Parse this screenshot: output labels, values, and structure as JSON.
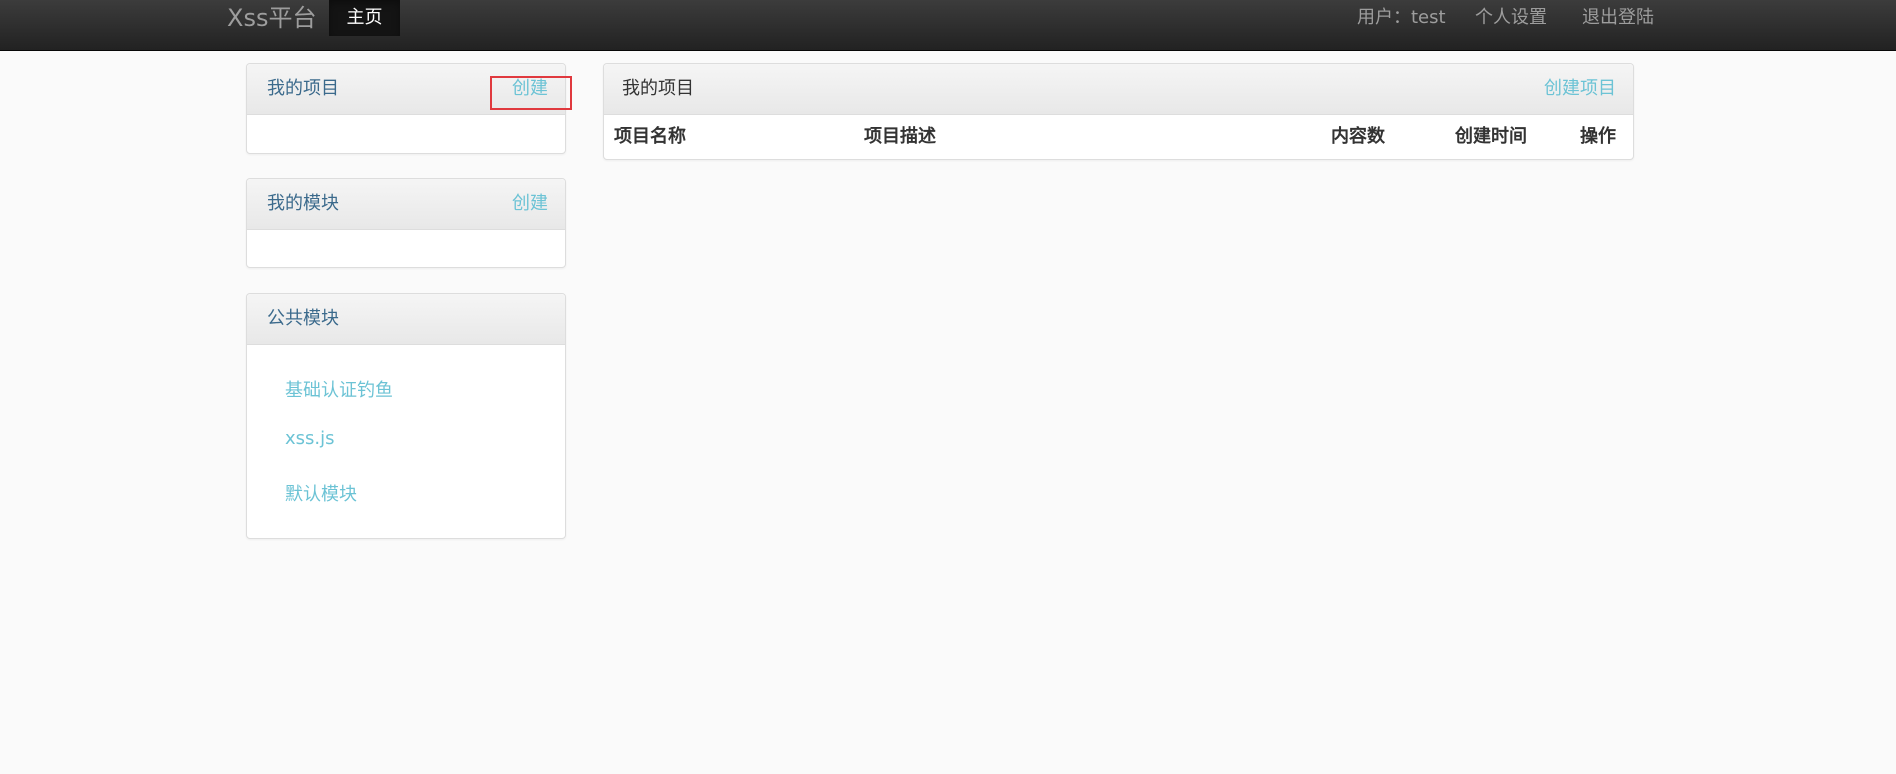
{
  "navbar": {
    "brand": "Xss平台",
    "active_tab": "主页",
    "user": "用户：test",
    "settings": "个人设置",
    "logout": "退出登陆"
  },
  "sidebar": {
    "my_projects": {
      "title": "我的项目",
      "create_label": "创建"
    },
    "my_modules": {
      "title": "我的模块",
      "create_label": "创建"
    },
    "public_modules": {
      "title": "公共模块",
      "items": [
        "基础认证钓鱼",
        "xss.js",
        "默认模块"
      ]
    }
  },
  "main": {
    "title": "我的项目",
    "create_label": "创建项目",
    "table": {
      "columns": [
        "项目名称",
        "项目描述",
        "内容数",
        "创建时间",
        "操作"
      ],
      "rows": []
    }
  },
  "colors": {
    "link": "#6cc3d5",
    "panel_title": "#3b6a8c",
    "highlight_box": "#e0393e",
    "navbar": "#222222"
  }
}
